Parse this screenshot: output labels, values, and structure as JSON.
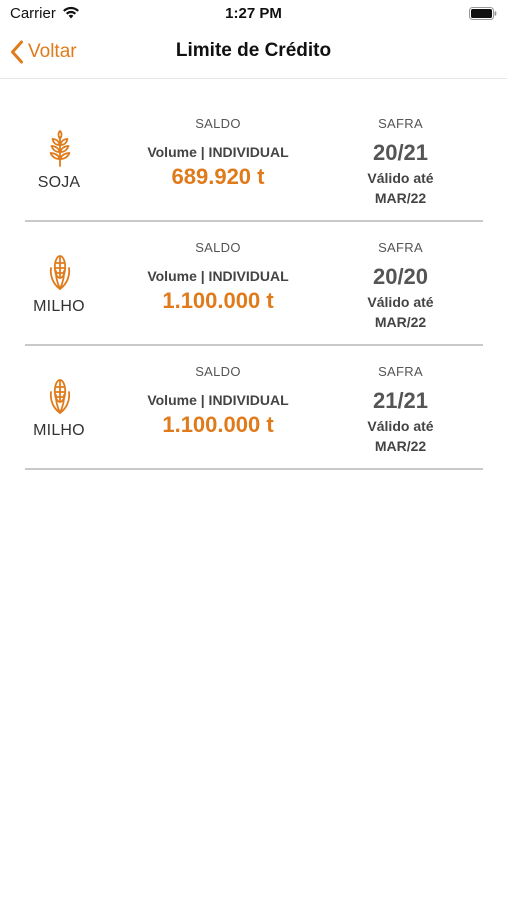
{
  "status_bar": {
    "carrier": "Carrier",
    "time": "1:27 PM"
  },
  "nav": {
    "back_label": "Voltar",
    "title": "Limite de Crédito"
  },
  "colors": {
    "accent": "#e07b1c"
  },
  "items": [
    {
      "crop": "SOJA",
      "icon": "wheat-icon",
      "saldo_label": "SALDO",
      "volume_type": "Volume | INDIVIDUAL",
      "saldo_value": "689.920 t",
      "safra_label": "SAFRA",
      "safra": "20/21",
      "valid_label": "Válido até",
      "valid_date": "MAR/22"
    },
    {
      "crop": "MILHO",
      "icon": "corn-icon",
      "saldo_label": "SALDO",
      "volume_type": "Volume | INDIVIDUAL",
      "saldo_value": "1.100.000 t",
      "safra_label": "SAFRA",
      "safra": "20/20",
      "valid_label": "Válido até",
      "valid_date": "MAR/22"
    },
    {
      "crop": "MILHO",
      "icon": "corn-icon",
      "saldo_label": "SALDO",
      "volume_type": "Volume | INDIVIDUAL",
      "saldo_value": "1.100.000 t",
      "safra_label": "SAFRA",
      "safra": "21/21",
      "valid_label": "Válido até",
      "valid_date": "MAR/22"
    }
  ]
}
